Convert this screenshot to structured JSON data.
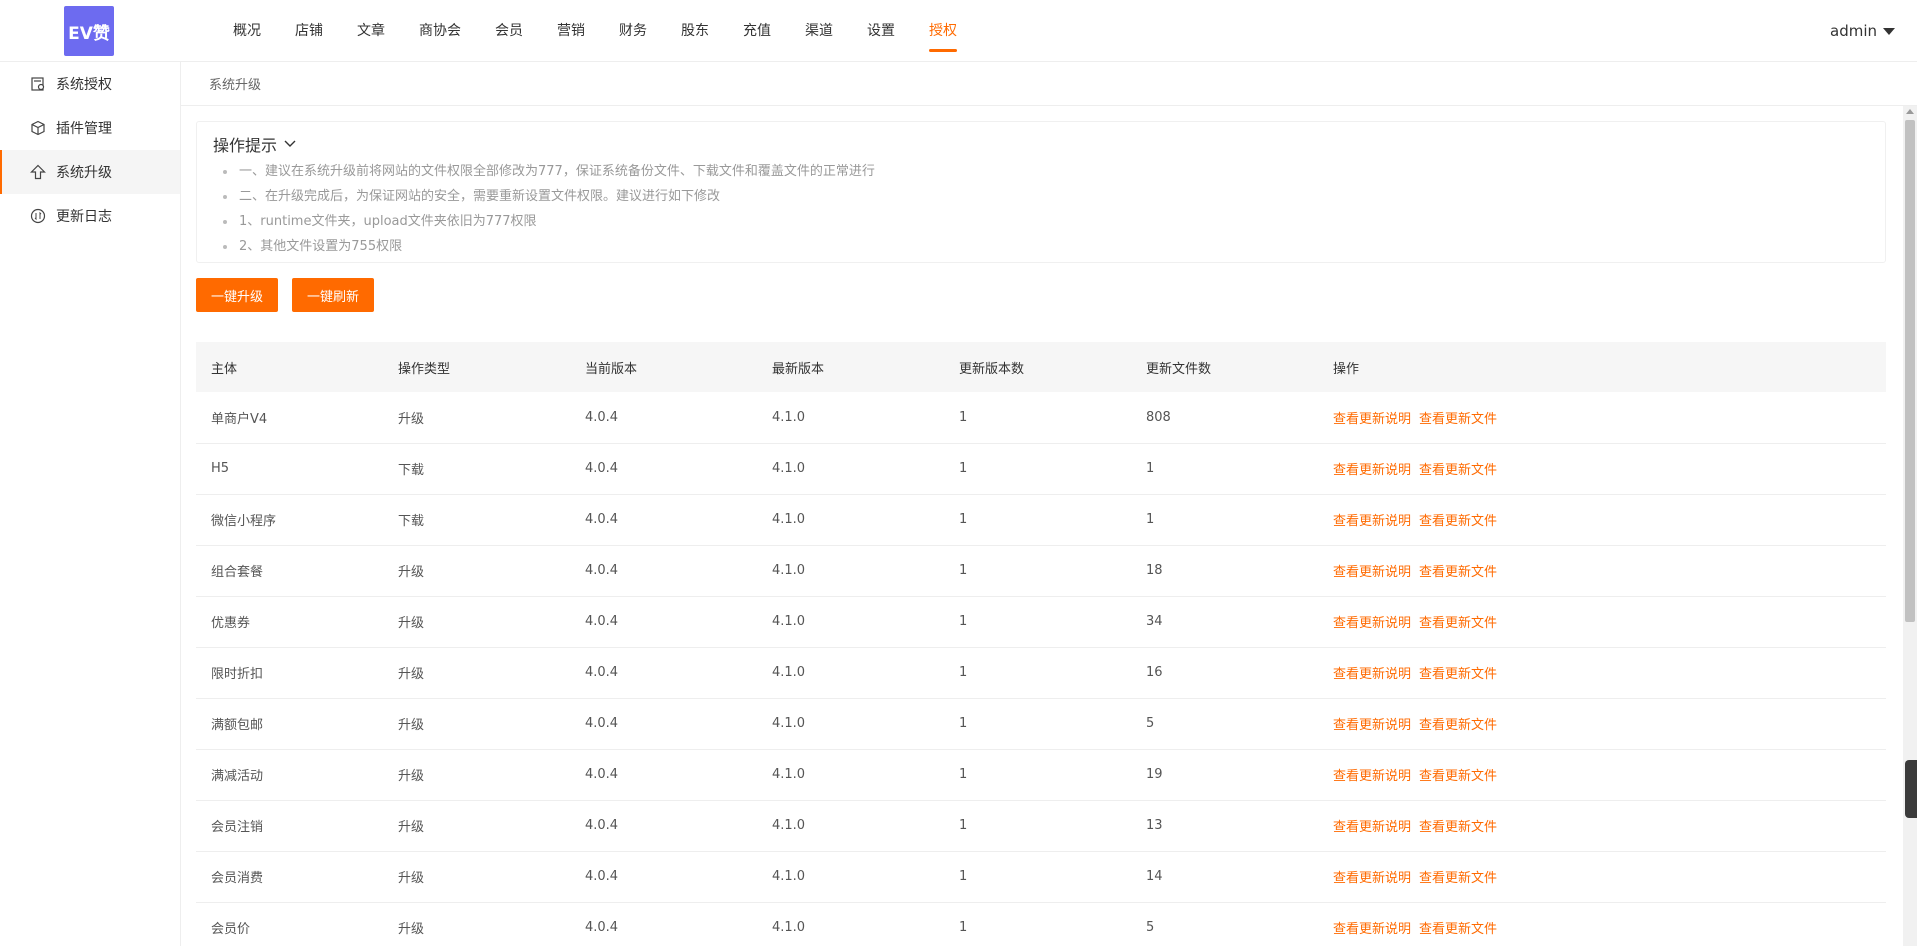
{
  "header": {
    "logo_text": "EV赞",
    "nav": [
      "概况",
      "店铺",
      "文章",
      "商协会",
      "会员",
      "营销",
      "财务",
      "股东",
      "充值",
      "渠道",
      "设置",
      "授权"
    ],
    "active_nav": "授权",
    "user": "admin"
  },
  "sidebar": {
    "items": [
      {
        "label": "系统授权",
        "icon": "license-icon"
      },
      {
        "label": "插件管理",
        "icon": "cube-icon"
      },
      {
        "label": "系统升级",
        "icon": "arrow-up-icon",
        "active": true
      },
      {
        "label": "更新日志",
        "icon": "log-icon"
      }
    ]
  },
  "breadcrumb": "系统升级",
  "tips": {
    "title": "操作提示",
    "items": [
      "一、建议在系统升级前将网站的文件权限全部修改为777，保证系统备份文件、下载文件和覆盖文件的正常进行",
      "二、在升级完成后，为保证网站的安全，需要重新设置文件权限。建议进行如下修改",
      "1、runtime文件夹，upload文件夹依旧为777权限",
      "2、其他文件设置为755权限"
    ]
  },
  "buttons": {
    "upgrade": "一键升级",
    "refresh": "一键刷新"
  },
  "table": {
    "headers": [
      "主体",
      "操作类型",
      "当前版本",
      "最新版本",
      "更新版本数",
      "更新文件数",
      "操作"
    ],
    "op_labels": [
      "查看更新说明",
      "查看更新文件"
    ],
    "rows": [
      [
        "单商户V4",
        "升级",
        "4.0.4",
        "4.1.0",
        "1",
        "808"
      ],
      [
        "H5",
        "下载",
        "4.0.4",
        "4.1.0",
        "1",
        "1"
      ],
      [
        "微信小程序",
        "下载",
        "4.0.4",
        "4.1.0",
        "1",
        "1"
      ],
      [
        "组合套餐",
        "升级",
        "4.0.4",
        "4.1.0",
        "1",
        "18"
      ],
      [
        "优惠券",
        "升级",
        "4.0.4",
        "4.1.0",
        "1",
        "34"
      ],
      [
        "限时折扣",
        "升级",
        "4.0.4",
        "4.1.0",
        "1",
        "16"
      ],
      [
        "满额包邮",
        "升级",
        "4.0.4",
        "4.1.0",
        "1",
        "5"
      ],
      [
        "满减活动",
        "升级",
        "4.0.4",
        "4.1.0",
        "1",
        "19"
      ],
      [
        "会员注销",
        "升级",
        "4.0.4",
        "4.1.0",
        "1",
        "13"
      ],
      [
        "会员消费",
        "升级",
        "4.0.4",
        "4.1.0",
        "1",
        "14"
      ],
      [
        "会员价",
        "升级",
        "4.0.4",
        "4.1.0",
        "1",
        "5"
      ]
    ]
  },
  "colors": {
    "accent": "#ff6a00",
    "logo_bg": "#6d6bf0"
  }
}
